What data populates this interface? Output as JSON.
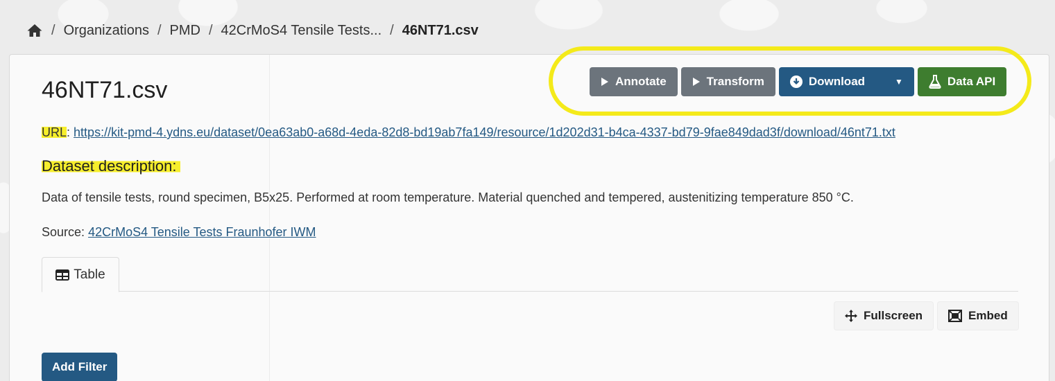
{
  "breadcrumb": {
    "home_icon": "home-icon",
    "separator": "/",
    "items": [
      "Organizations",
      "PMD",
      "42CrMoS4 Tensile Tests..."
    ],
    "current": "46NT71.csv"
  },
  "resource": {
    "title": "46NT71.csv",
    "url_label": "URL",
    "url_suffix": ":",
    "url": "https://kit-pmd-4.ydns.eu/dataset/0ea63ab0-a68d-4eda-82d8-bd19ab7fa149/resource/1d202d31-b4ca-4337-bd79-9fae849dad3f/download/46nt71.txt",
    "description_heading": "Dataset description:",
    "description": "Data of tensile tests, round specimen, B5x25. Performed at room temperature. Material quenched and tempered, austenitizing temperature 850 °C.",
    "source_label": "Source:",
    "source_link": "42CrMoS4 Tensile Tests Fraunhofer IWM"
  },
  "actions": {
    "annotate": "Annotate",
    "transform": "Transform",
    "download": "Download",
    "data_api": "Data API"
  },
  "view": {
    "tabs": [
      {
        "label": "Table",
        "icon": "table-icon"
      }
    ],
    "fullscreen": "Fullscreen",
    "embed": "Embed",
    "add_filter": "Add Filter"
  },
  "colors": {
    "primary": "#245983",
    "secondary": "#6c747c",
    "success": "#3e7d2f",
    "highlight": "#f4ea1a"
  }
}
